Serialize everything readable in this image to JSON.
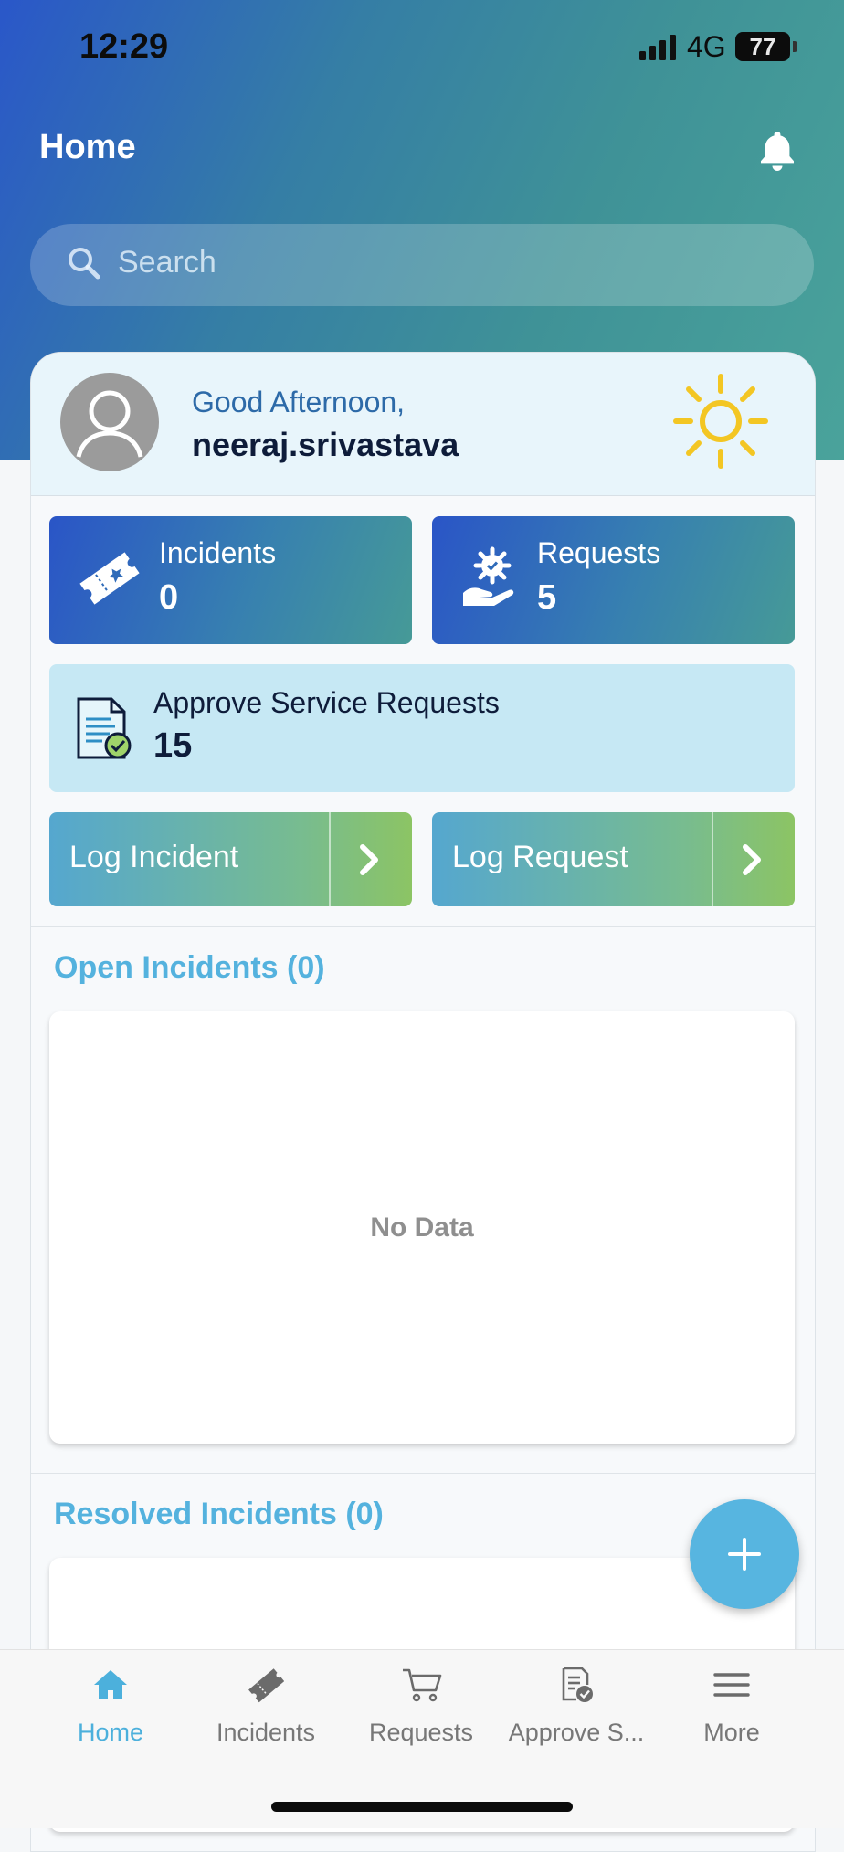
{
  "status_bar": {
    "time": "12:29",
    "network": "4G",
    "battery": "77"
  },
  "header": {
    "title": "Home"
  },
  "search": {
    "placeholder": "Search"
  },
  "greeting": {
    "salutation": "Good Afternoon,",
    "username": "neeraj.srivastava"
  },
  "tiles": {
    "incidents": {
      "label": "Incidents",
      "count": "0"
    },
    "requests": {
      "label": "Requests",
      "count": "5"
    },
    "approve": {
      "label": "Approve Service Requests",
      "count": "15"
    }
  },
  "actions": {
    "log_incident": "Log Incident",
    "log_request": "Log Request"
  },
  "sections": {
    "open": {
      "title": "Open Incidents (0)",
      "empty": "No Data"
    },
    "resolved": {
      "title": "Resolved Incidents (0)"
    }
  },
  "tabs": [
    {
      "label": "Home",
      "icon": "home-icon",
      "active": true
    },
    {
      "label": "Incidents",
      "icon": "ticket-icon"
    },
    {
      "label": "Requests",
      "icon": "cart-icon"
    },
    {
      "label": "Approve S...",
      "icon": "approve-doc-icon"
    },
    {
      "label": "More",
      "icon": "menu-icon"
    }
  ],
  "colors": {
    "accent": "#54b2de",
    "hero_start": "#2a57c9",
    "hero_end": "#4aa39b",
    "approve_bg": "#c6e8f4"
  }
}
